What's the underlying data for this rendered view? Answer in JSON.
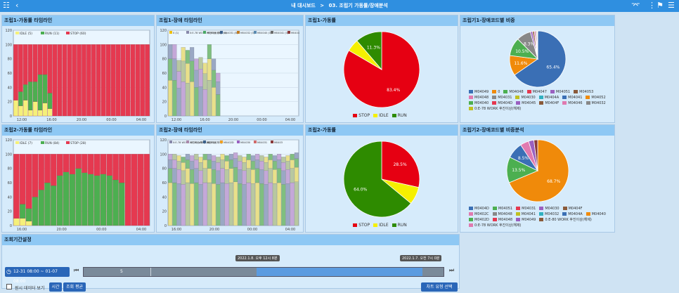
{
  "header": {
    "crumb_root": "내 대시보드",
    "crumb_sep": ">",
    "crumb_page": "03. 조립기 가동률/장애분석"
  },
  "panels": {
    "p1": "조립1-가동률 타임라인",
    "p2": "조립1-장애 타임라인",
    "p3": "조립1-가동률",
    "p4": "조립기1-장애코드별 비중",
    "p5": "조립2-가동률 타임라인",
    "p6": "조립2-장애 타임라인",
    "p7": "조립2-가동률",
    "p8": "조립기2-장애코드별 비중분석",
    "p9": "조회기간설정"
  },
  "legends": {
    "t1": [
      {
        "label": "IDLE (5)",
        "color": "#f5f07a"
      },
      {
        "label": "RUN (11)",
        "color": "#4caf50"
      },
      {
        "label": "STOP (60)",
        "color": "#e53950"
      }
    ],
    "t2": [
      {
        "label": "IDLE (7)",
        "color": "#f5f07a"
      },
      {
        "label": "RUN (84)",
        "color": "#4caf50"
      },
      {
        "label": "STOP (28)",
        "color": "#e53950"
      }
    ],
    "f1": [
      {
        "label": "0 (1)",
        "color": "#f0c000"
      },
      {
        "label": "0:E-78 WORK 후진이상(해제) (1)",
        "color": "#8888aa"
      },
      {
        "label": "M04030 (3)",
        "color": "#4aa866"
      },
      {
        "label": "M04031 (8)",
        "color": "#3a5f8a"
      },
      {
        "label": "M04032 (0)",
        "color": "#c07a20"
      },
      {
        "label": "M04040 (0)",
        "color": "#5a8ab0"
      },
      {
        "label": "M04041 (0)",
        "color": "#6a6a6a"
      },
      {
        "label": "M0404",
        "color": "#8a3a3a"
      }
    ],
    "f2": [
      {
        "label": "0:E-78 WORK 후진이상(해제) (1)",
        "color": "#8888aa"
      },
      {
        "label": "0:E-80 WORK 후진이상(해제)",
        "color": "#aa88aa"
      },
      {
        "label": "M0402C",
        "color": "#3a5f8a"
      },
      {
        "label": "M0402D",
        "color": "#f0a020"
      },
      {
        "label": "M04030",
        "color": "#9a60c0"
      },
      {
        "label": "M04031",
        "color": "#d06a6a"
      },
      {
        "label": "M0403",
        "color": "#8a3a3a"
      }
    ],
    "pie": [
      {
        "label": "STOP",
        "color": "#e60012"
      },
      {
        "label": "IDLE",
        "color": "#f5f000"
      },
      {
        "label": "RUN",
        "color": "#2e8b00"
      }
    ]
  },
  "axes": {
    "y": [
      "120",
      "100",
      "80",
      "60",
      "40",
      "20",
      "0"
    ],
    "x1": [
      "12:00",
      "16:00",
      "20:00",
      "00:00",
      "04:00"
    ],
    "x2": [
      "16:00",
      "20:00",
      "00:00",
      "04:00"
    ]
  },
  "chart_data": [
    {
      "type": "pie",
      "title": "조립1-가동률",
      "categories": [
        "STOP",
        "IDLE",
        "RUN"
      ],
      "values": [
        83.4,
        5.3,
        11.3
      ],
      "labels": [
        "83.4%",
        "",
        "11.3%"
      ]
    },
    {
      "type": "pie",
      "title": "조립2-가동률",
      "categories": [
        "STOP",
        "IDLE",
        "RUN"
      ],
      "values": [
        28.5,
        7.5,
        64.0
      ],
      "labels": [
        "28.5%",
        "",
        "64.0%"
      ]
    },
    {
      "type": "pie",
      "title": "조립기1-장애코드별 비중",
      "categories": [
        "M04049",
        "0",
        "M04048",
        "M04047",
        "M04051",
        "M04053",
        "M04046",
        "M04032",
        "0:E-78 WORK 후진이상",
        "기타"
      ],
      "values": [
        65.4,
        11.6,
        10.5,
        8.3,
        1.2,
        1.0,
        0.8,
        0.6,
        0.4,
        0.2
      ],
      "labels": [
        "65.4%",
        "11.6%",
        "10.5%",
        "8.3%"
      ],
      "colors": [
        "#3a6fb5",
        "#f08a0a",
        "#4caf50",
        "#888888",
        "#9a60c0",
        "#8a5a3a",
        "#e07ab0",
        "#6a6a6a",
        "#c0c020",
        "#30b0c0"
      ]
    },
    {
      "type": "pie",
      "title": "조립기2-장애코드별 비중분석",
      "categories": [
        "M0402D",
        "M04032",
        "M04051",
        "M04041",
        "M04031",
        "기타"
      ],
      "values": [
        68.7,
        13.5,
        8.5,
        4.5,
        2.8,
        2.0
      ],
      "labels": [
        "68.7%",
        "13.5%",
        "8.5%"
      ],
      "colors": [
        "#f08a0a",
        "#4caf50",
        "#3a6fb5",
        "#e07ab0",
        "#9a60c0",
        "#8a3a3a"
      ]
    }
  ],
  "code_legend1": [
    {
      "label": "M04049",
      "color": "#3a6fb5"
    },
    {
      "label": "0",
      "color": "#f08a0a"
    },
    {
      "label": "M04048",
      "color": "#4caf50"
    },
    {
      "label": "M04047",
      "color": "#e53950"
    },
    {
      "label": "M04051",
      "color": "#9a60c0"
    },
    {
      "label": "M04053",
      "color": "#8a5a3a"
    },
    {
      "label": "M04048",
      "color": "#e07ab0"
    },
    {
      "label": "M04031",
      "color": "#888888"
    },
    {
      "label": "M04030",
      "color": "#c0c020"
    },
    {
      "label": "M0404A",
      "color": "#30b0c0"
    },
    {
      "label": "M04041",
      "color": "#3a6fb5"
    },
    {
      "label": "M04052",
      "color": "#f08a0a"
    },
    {
      "label": "M04040",
      "color": "#4caf50"
    },
    {
      "label": "M0404D",
      "color": "#e53950"
    },
    {
      "label": "M04045",
      "color": "#9a60c0"
    },
    {
      "label": "M0404F",
      "color": "#8a5a3a"
    },
    {
      "label": "M04046",
      "color": "#e07ab0"
    },
    {
      "label": "M04032",
      "color": "#888888"
    },
    {
      "label": "0:E-78 WORK 후진이상(해제)",
      "color": "#c0c020"
    }
  ],
  "code_legend2": [
    {
      "label": "M0404D",
      "color": "#3a6fb5"
    },
    {
      "label": "M04051",
      "color": "#4caf50"
    },
    {
      "label": "M04031",
      "color": "#e53950"
    },
    {
      "label": "M04030",
      "color": "#9a60c0"
    },
    {
      "label": "M0404F",
      "color": "#8a5a3a"
    },
    {
      "label": "M0402C",
      "color": "#e07ab0"
    },
    {
      "label": "M04048",
      "color": "#888888"
    },
    {
      "label": "M04041",
      "color": "#c0c020"
    },
    {
      "label": "M04032",
      "color": "#30b0c0"
    },
    {
      "label": "M0404A",
      "color": "#3a6fb5"
    },
    {
      "label": "M04040",
      "color": "#f08a0a"
    },
    {
      "label": "M0402D",
      "color": "#4caf50"
    },
    {
      "label": "M04048",
      "color": "#e53950"
    },
    {
      "label": "M04049",
      "color": "#9a60c0"
    },
    {
      "label": "0:E-80 WORK 후진이상(해제)",
      "color": "#8a5a3a"
    },
    {
      "label": "0:E-78 WORK 후진이상(해제)",
      "color": "#e07ab0"
    }
  ],
  "period": {
    "range": "12-31 08:00 ~ 01-07 08:00",
    "slider_value": "5",
    "handle_left": "2022.1.8. 오후 12시 8분",
    "handle_right": "2022.1.7. 오전 7시 0분",
    "checkbox_label": "원시 데이터 보기",
    "btn_time": "시간",
    "btn_avg": "조회 평균",
    "btn_chart_type": "차트 유형 선택"
  }
}
